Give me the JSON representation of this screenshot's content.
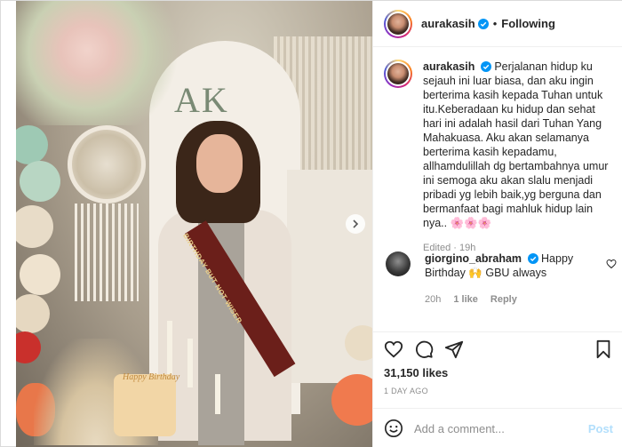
{
  "post": {
    "username": "aurakasih",
    "follow_status": "Following",
    "separator": "•",
    "arch_label": "AK",
    "sash_text": "BIRTHDAY BUT NOT WISER",
    "cake_topper": "Happy Birthday"
  },
  "caption": {
    "username": "aurakasih",
    "text": "Perjalanan hidup ku sejauh ini luar biasa, dan aku ingin berterima kasih kepada Tuhan untuk itu.Keberadaan ku hidup dan sehat hari ini adalah hasil dari Tuhan Yang Mahakuasa. Aku akan selamanya berterima kasih kepadamu, allhamdulillah dg bertambahnya umur ini semoga aku akan slalu menjadi pribadi yg lebih baik,yg berguna dan bermanfaat bagi mahluk hidup lain nya.. 🌸🌸🌸",
    "meta": "Edited · 19h"
  },
  "comment": {
    "username": "giorgino_abraham",
    "text": "Happy Birthday 🙌 GBU always",
    "time": "20h",
    "likes": "1 like",
    "reply": "Reply"
  },
  "stats": {
    "likes": "31,150 likes",
    "date": "1 DAY AGO"
  },
  "add_comment": {
    "placeholder": "Add a comment...",
    "post_label": "Post"
  },
  "icons": {
    "verified": "verified-badge-icon",
    "like": "heart-icon",
    "comment": "comment-icon",
    "share": "paper-plane-icon",
    "save": "bookmark-icon",
    "emoji": "smiley-icon",
    "next": "chevron-right-icon"
  },
  "colors": {
    "verified_blue": "#0095f6",
    "post_disabled": "#b2dffc",
    "meta_gray": "#8e8e8e"
  }
}
